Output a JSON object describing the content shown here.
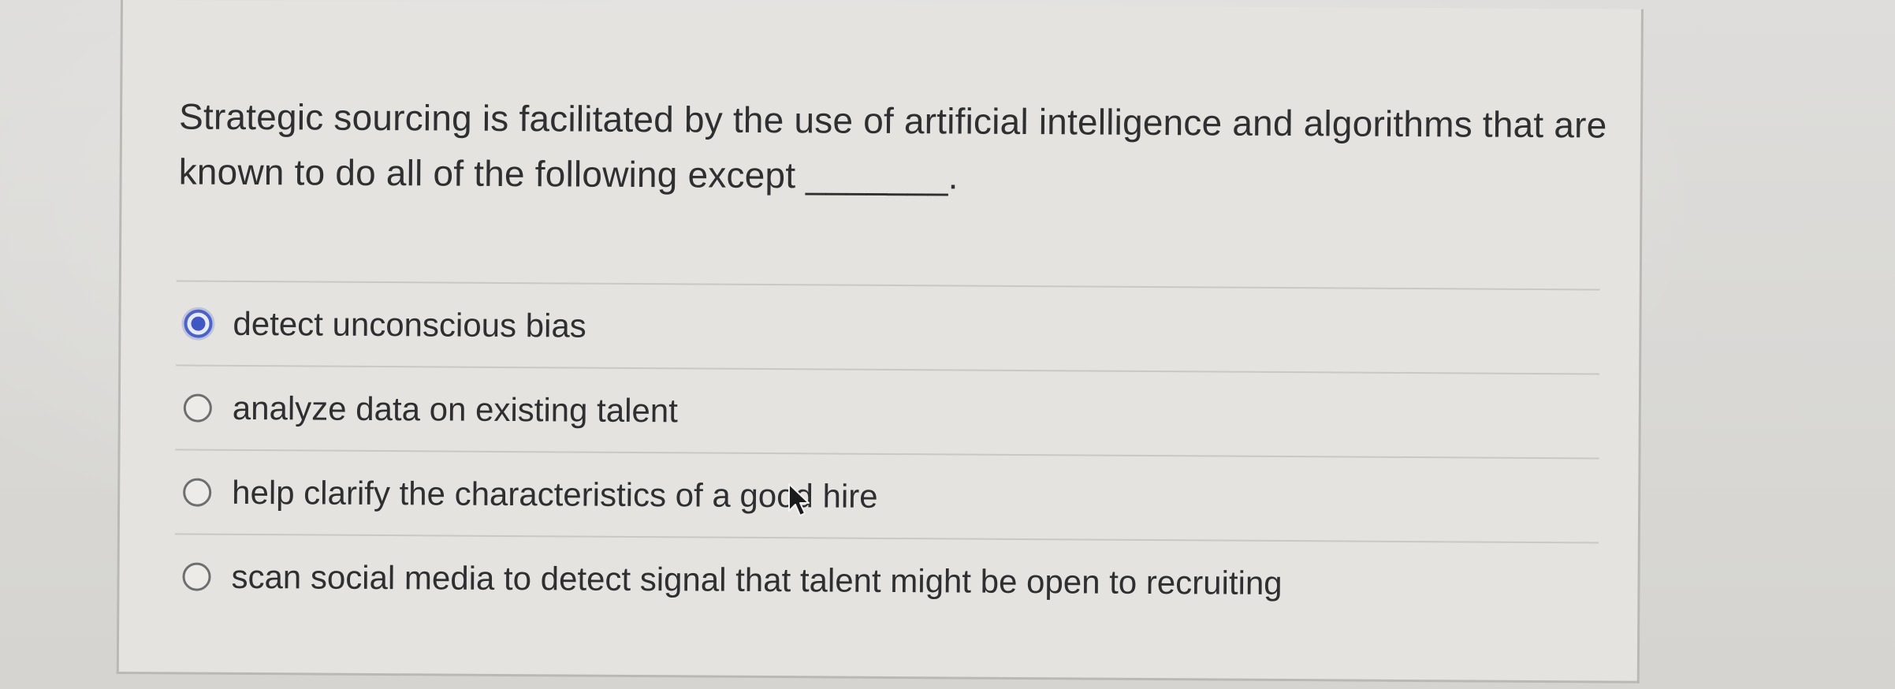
{
  "question": {
    "text": "Strategic sourcing is facilitated by the use of artificial intelligence and algorithms that are known to do all of the following except _______."
  },
  "options": [
    {
      "label": "detect unconscious bias",
      "selected": true
    },
    {
      "label": "analyze data on existing talent",
      "selected": false
    },
    {
      "label": "help clarify the characteristics of a good hire",
      "selected": false
    },
    {
      "label": "scan social media to detect signal that talent might be open to recruiting",
      "selected": false
    }
  ],
  "colors": {
    "selected_radio": "#3f57c4",
    "text": "#2f2f31",
    "background": "#e4e3e0"
  },
  "icons": {
    "cursor": "mouse-pointer-icon"
  }
}
